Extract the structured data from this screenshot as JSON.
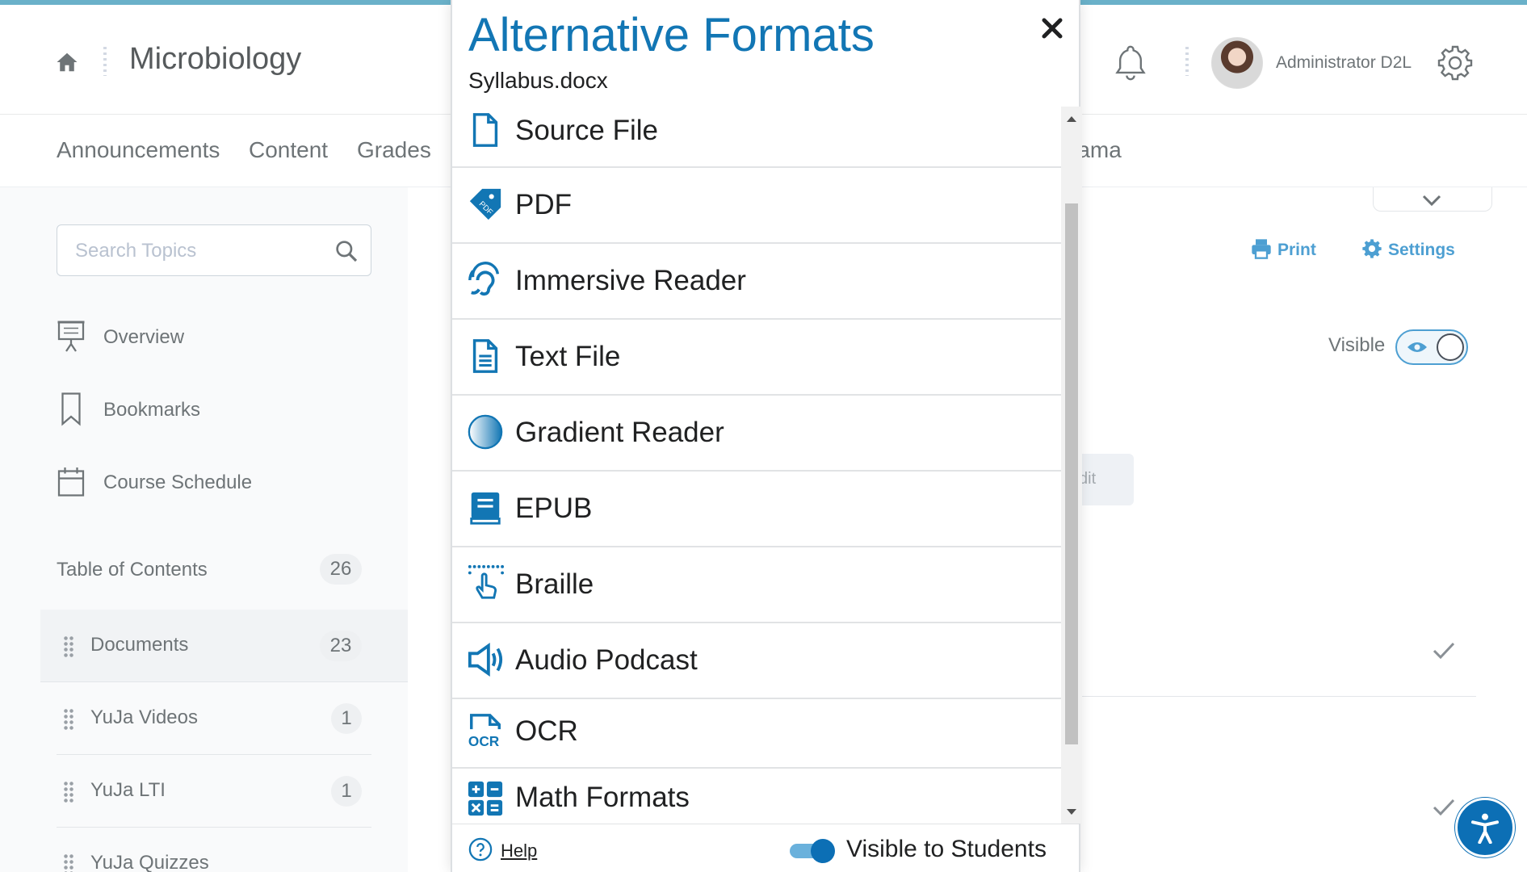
{
  "header": {
    "course_title": "Microbiology",
    "user_name": "Administrator D2L"
  },
  "nav": {
    "items": [
      "Announcements",
      "Content",
      "Grades",
      "rama"
    ]
  },
  "sidebar": {
    "search_placeholder": "Search Topics",
    "links": [
      {
        "label": "Overview",
        "icon": "presentation-icon"
      },
      {
        "label": "Bookmarks",
        "icon": "bookmark-icon"
      },
      {
        "label": "Course Schedule",
        "icon": "calendar-icon"
      }
    ],
    "toc": {
      "label": "Table of Contents",
      "count": "26"
    },
    "modules": [
      {
        "label": "Documents",
        "count": "23"
      },
      {
        "label": "YuJa Videos",
        "count": "1"
      },
      {
        "label": "YuJa LTI",
        "count": "1"
      },
      {
        "label": "YuJa Quizzes",
        "count": ""
      }
    ]
  },
  "main": {
    "print_label": "Print",
    "settings_label": "Settings",
    "visible_label": "Visible",
    "partial_button_label": "dit"
  },
  "modal": {
    "title": "Alternative Formats",
    "filename": "Syllabus.docx",
    "formats": [
      {
        "label": "Source File",
        "icon": "file-icon"
      },
      {
        "label": "PDF",
        "icon": "pdf-tag-icon"
      },
      {
        "label": "Immersive Reader",
        "icon": "hearing-icon"
      },
      {
        "label": "Text File",
        "icon": "text-file-icon"
      },
      {
        "label": "Gradient Reader",
        "icon": "gradient-circle-icon"
      },
      {
        "label": "EPUB",
        "icon": "book-icon"
      },
      {
        "label": "Braille",
        "icon": "braille-icon"
      },
      {
        "label": "Audio Podcast",
        "icon": "speaker-icon"
      },
      {
        "label": "OCR",
        "icon": "ocr-icon"
      },
      {
        "label": "Math Formats",
        "icon": "calculator-icon"
      }
    ],
    "footer": {
      "help_label": "Help",
      "visible_to_students_label": "Visible to Students",
      "visible_to_students": true
    }
  },
  "colors": {
    "accent": "#1276b4",
    "link": "#4d9fd2",
    "top_accent": "#6ab1c9"
  }
}
